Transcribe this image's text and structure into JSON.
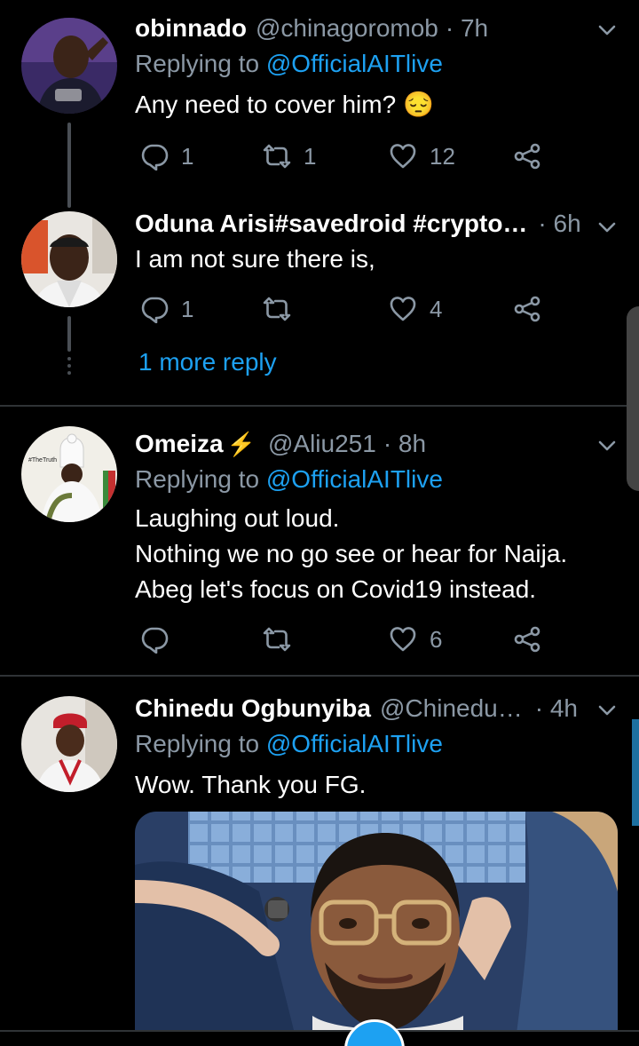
{
  "tweets": [
    {
      "name": "obinnado",
      "handle": "@chinagoromob",
      "time": "· 7h",
      "replying_prefix": "Replying to ",
      "replying_to": "@OfficialAITlive",
      "text": "Any need to cover him? 😔",
      "replies": "1",
      "retweets": "1",
      "likes": "12"
    },
    {
      "name": "Oduna Arisi#savedroid #crypto…",
      "time": "· 6h",
      "text": "I am not sure there is,",
      "replies": "1",
      "retweets": "",
      "likes": "4"
    },
    {
      "name": "Omeiza",
      "bolt": "⚡",
      "handle": "@Aliu251",
      "time": "· 8h",
      "replying_prefix": "Replying to ",
      "replying_to": "@OfficialAITlive",
      "text_lines": [
        "Laughing out loud.",
        "Nothing we no go see or hear for Naija.",
        "Abeg let's focus on Covid19 instead."
      ],
      "replies": "",
      "retweets": "",
      "likes": "6",
      "avatar_caption": "#TheTruth"
    },
    {
      "name": "Chinedu Ogbunyiba",
      "handle": "@Chinedu…",
      "time": "· 4h",
      "replying_prefix": "Replying to ",
      "replying_to": "@OfficialAITlive",
      "text": "Wow. Thank you FG."
    }
  ],
  "more_reply": "1 more reply",
  "icons": {
    "reply": "reply-icon",
    "retweet": "retweet-icon",
    "like": "heart-icon",
    "share": "share-icon",
    "menu": "chevron-down-icon"
  },
  "colors": {
    "background": "#000000",
    "link": "#1da1f2",
    "muted": "#8b98a5",
    "divider": "#2f3336",
    "thread_line": "#4a4f55"
  }
}
